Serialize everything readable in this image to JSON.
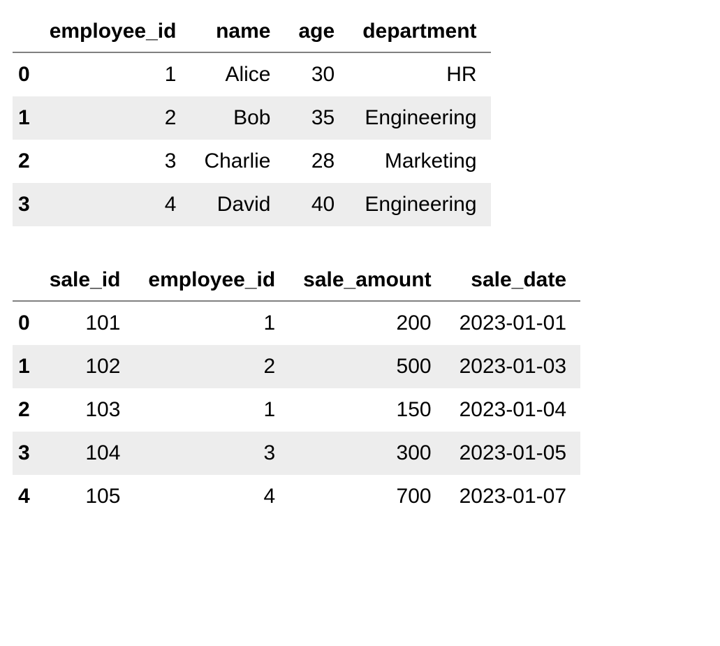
{
  "tables": [
    {
      "columns": [
        "employee_id",
        "name",
        "age",
        "department"
      ],
      "rows": [
        {
          "idx": "0",
          "cells": [
            "1",
            "Alice",
            "30",
            "HR"
          ]
        },
        {
          "idx": "1",
          "cells": [
            "2",
            "Bob",
            "35",
            "Engineering"
          ]
        },
        {
          "idx": "2",
          "cells": [
            "3",
            "Charlie",
            "28",
            "Marketing"
          ]
        },
        {
          "idx": "3",
          "cells": [
            "4",
            "David",
            "40",
            "Engineering"
          ]
        }
      ]
    },
    {
      "columns": [
        "sale_id",
        "employee_id",
        "sale_amount",
        "sale_date"
      ],
      "rows": [
        {
          "idx": "0",
          "cells": [
            "101",
            "1",
            "200",
            "2023-01-01"
          ]
        },
        {
          "idx": "1",
          "cells": [
            "102",
            "2",
            "500",
            "2023-01-03"
          ]
        },
        {
          "idx": "2",
          "cells": [
            "103",
            "1",
            "150",
            "2023-01-04"
          ]
        },
        {
          "idx": "3",
          "cells": [
            "104",
            "3",
            "300",
            "2023-01-05"
          ]
        },
        {
          "idx": "4",
          "cells": [
            "105",
            "4",
            "700",
            "2023-01-07"
          ]
        }
      ]
    }
  ],
  "chart_data": [
    {
      "type": "table",
      "title": "",
      "columns": [
        "employee_id",
        "name",
        "age",
        "department"
      ],
      "index": [
        0,
        1,
        2,
        3
      ],
      "data": [
        [
          1,
          "Alice",
          30,
          "HR"
        ],
        [
          2,
          "Bob",
          35,
          "Engineering"
        ],
        [
          3,
          "Charlie",
          28,
          "Marketing"
        ],
        [
          4,
          "David",
          40,
          "Engineering"
        ]
      ]
    },
    {
      "type": "table",
      "title": "",
      "columns": [
        "sale_id",
        "employee_id",
        "sale_amount",
        "sale_date"
      ],
      "index": [
        0,
        1,
        2,
        3,
        4
      ],
      "data": [
        [
          101,
          1,
          200,
          "2023-01-01"
        ],
        [
          102,
          2,
          500,
          "2023-01-03"
        ],
        [
          103,
          1,
          150,
          "2023-01-04"
        ],
        [
          104,
          3,
          300,
          "2023-01-05"
        ],
        [
          105,
          4,
          700,
          "2023-01-07"
        ]
      ]
    }
  ]
}
